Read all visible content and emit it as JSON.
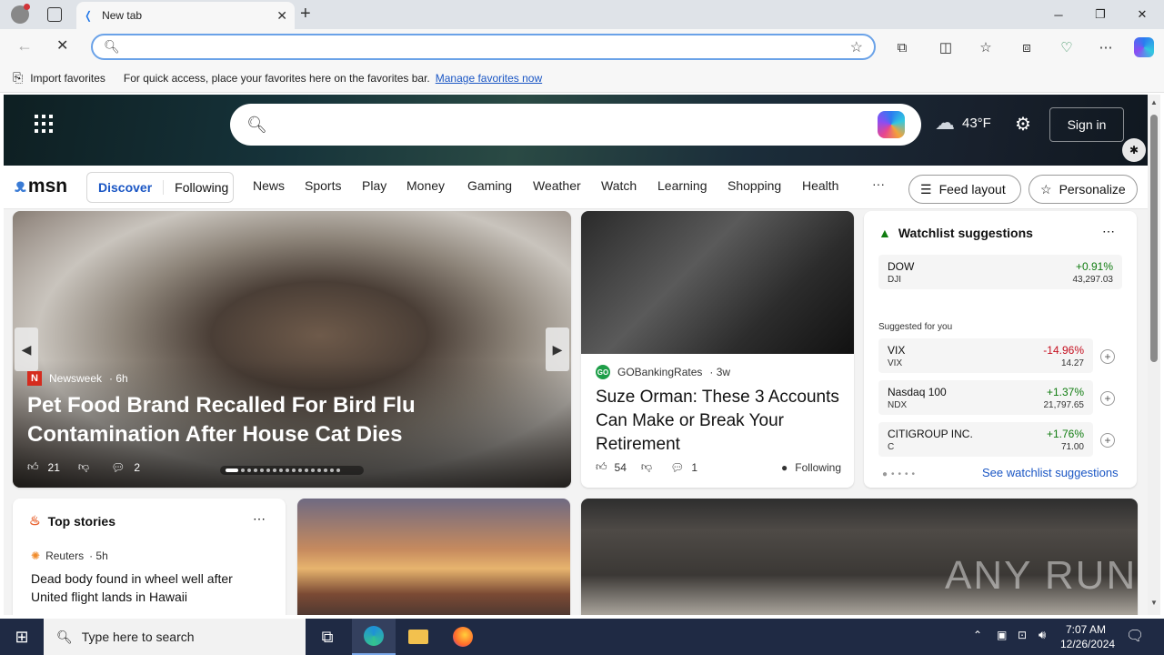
{
  "browser": {
    "tab_title": "New tab",
    "address_placeholder": "",
    "favbar_import": "Import favorites",
    "favbar_text": "For quick access, place your favorites here on the favorites bar.",
    "favbar_link": "Manage favorites now"
  },
  "msn": {
    "search_placeholder": "",
    "weather_temp": "43°F",
    "signin": "Sign in",
    "logo": "msn",
    "feed_tabs": [
      "Discover",
      "Following"
    ],
    "nav": [
      "News",
      "Sports",
      "Play",
      "Money",
      "Gaming",
      "Weather",
      "Watch",
      "Learning",
      "Shopping",
      "Health"
    ],
    "more": "···",
    "feed_layout": "Feed layout",
    "personalize": "Personalize"
  },
  "hero": {
    "source": "Newsweek",
    "age": "· 6h",
    "title": "Pet Food Brand Recalled For Bird Flu Contamination After House Cat Dies",
    "likes": "21",
    "comments": "2"
  },
  "suze": {
    "source": "GOBankingRates",
    "age": "· 3w",
    "title": "Suze Orman: These 3 Accounts Can Make or Break Your Retirement",
    "likes": "54",
    "comments": "1",
    "following": "Following"
  },
  "watchlist": {
    "title": "Watchlist suggestions",
    "suggested_label": "Suggested for you",
    "see_more": "See watchlist suggestions",
    "top": {
      "name": "DOW",
      "symbol": "DJI",
      "change": "+0.91%",
      "value": "43,297.03"
    },
    "items": [
      {
        "name": "VIX",
        "symbol": "VIX",
        "change": "-14.96%",
        "value": "14.27"
      },
      {
        "name": "Nasdaq 100",
        "symbol": "NDX",
        "change": "+1.37%",
        "value": "21,797.65"
      },
      {
        "name": "CITIGROUP INC.",
        "symbol": "C",
        "change": "+1.76%",
        "value": "71.00"
      }
    ]
  },
  "top_stories": {
    "title": "Top stories",
    "source": "Reuters",
    "age": "· 5h",
    "headline": "Dead body found in wheel well after United flight lands in Hawaii"
  },
  "watermark": "ANY RUN",
  "taskbar": {
    "search_placeholder": "Type here to search",
    "time": "7:07 AM",
    "date": "12/26/2024"
  },
  "colors": {
    "accent": "#1a56c4",
    "positive": "#107c10",
    "negative": "#c50f1f"
  }
}
